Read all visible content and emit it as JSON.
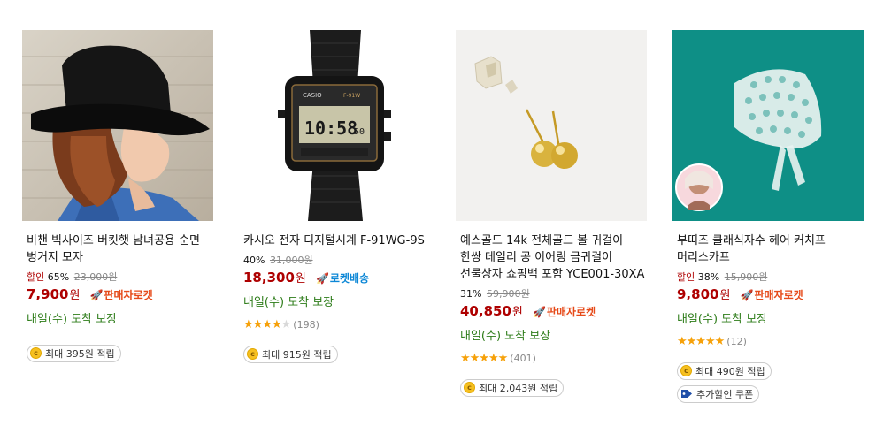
{
  "products": [
    {
      "title": "비챈 빅사이즈 버킷햇 남녀공용 순면 벙거지 모자",
      "sale_label": "할인",
      "discount": "65%",
      "original_price": "23,000원",
      "price": "7,900",
      "won": "원",
      "rocket_label": "판매자로켓",
      "delivery": "내일(수) 도착 보장",
      "points": "최대 395원 적립"
    },
    {
      "title": "카시오 전자 디지털시계 F-91WG-9S",
      "discount": "40%",
      "original_price": "31,000원",
      "price": "18,300",
      "won": "원",
      "rocket_label": "로켓배송",
      "delivery": "내일(수) 도착 보장",
      "rating": 4.5,
      "review_count": "(198)",
      "points": "최대 915원 적립"
    },
    {
      "title": "예스골드 14k 전체골드 볼 귀걸이 한쌍 데일리 공 이어링 금귀걸이 선물상자 쇼핑백 포함 YCE001-30XA",
      "discount": "31%",
      "original_price": "59,900원",
      "price": "40,850",
      "won": "원",
      "rocket_label": "판매자로켓",
      "delivery": "내일(수) 도착 보장",
      "rating": 5,
      "review_count": "(401)",
      "points": "최대 2,043원 적립"
    },
    {
      "title": "부띠즈 클래식자수 헤어 커치프 머리스카프",
      "sale_label": "할인",
      "discount": "38%",
      "original_price": "15,900원",
      "price": "9,800",
      "won": "원",
      "rocket_label": "판매자로켓",
      "delivery": "내일(수) 도착 보장",
      "rating": 5,
      "review_count": "(12)",
      "points": "최대 490원 적립",
      "coupon": "추가할인 쿠폰"
    }
  ],
  "watch_display": {
    "brand": "CASIO",
    "model": "F-91W",
    "time": "10:58",
    "seconds": "50"
  },
  "colors": {
    "price_red": "#ae0000",
    "delivery_green": "#2d7c19",
    "star_orange": "#f6a10a",
    "seller_rocket": "#e64a19",
    "coupang_rocket": "#0c87d6",
    "kerchief_bg": "#0e8f86"
  },
  "icons": [
    "rocket-icon",
    "star-icon",
    "coin-icon",
    "coupon-tag-icon"
  ]
}
